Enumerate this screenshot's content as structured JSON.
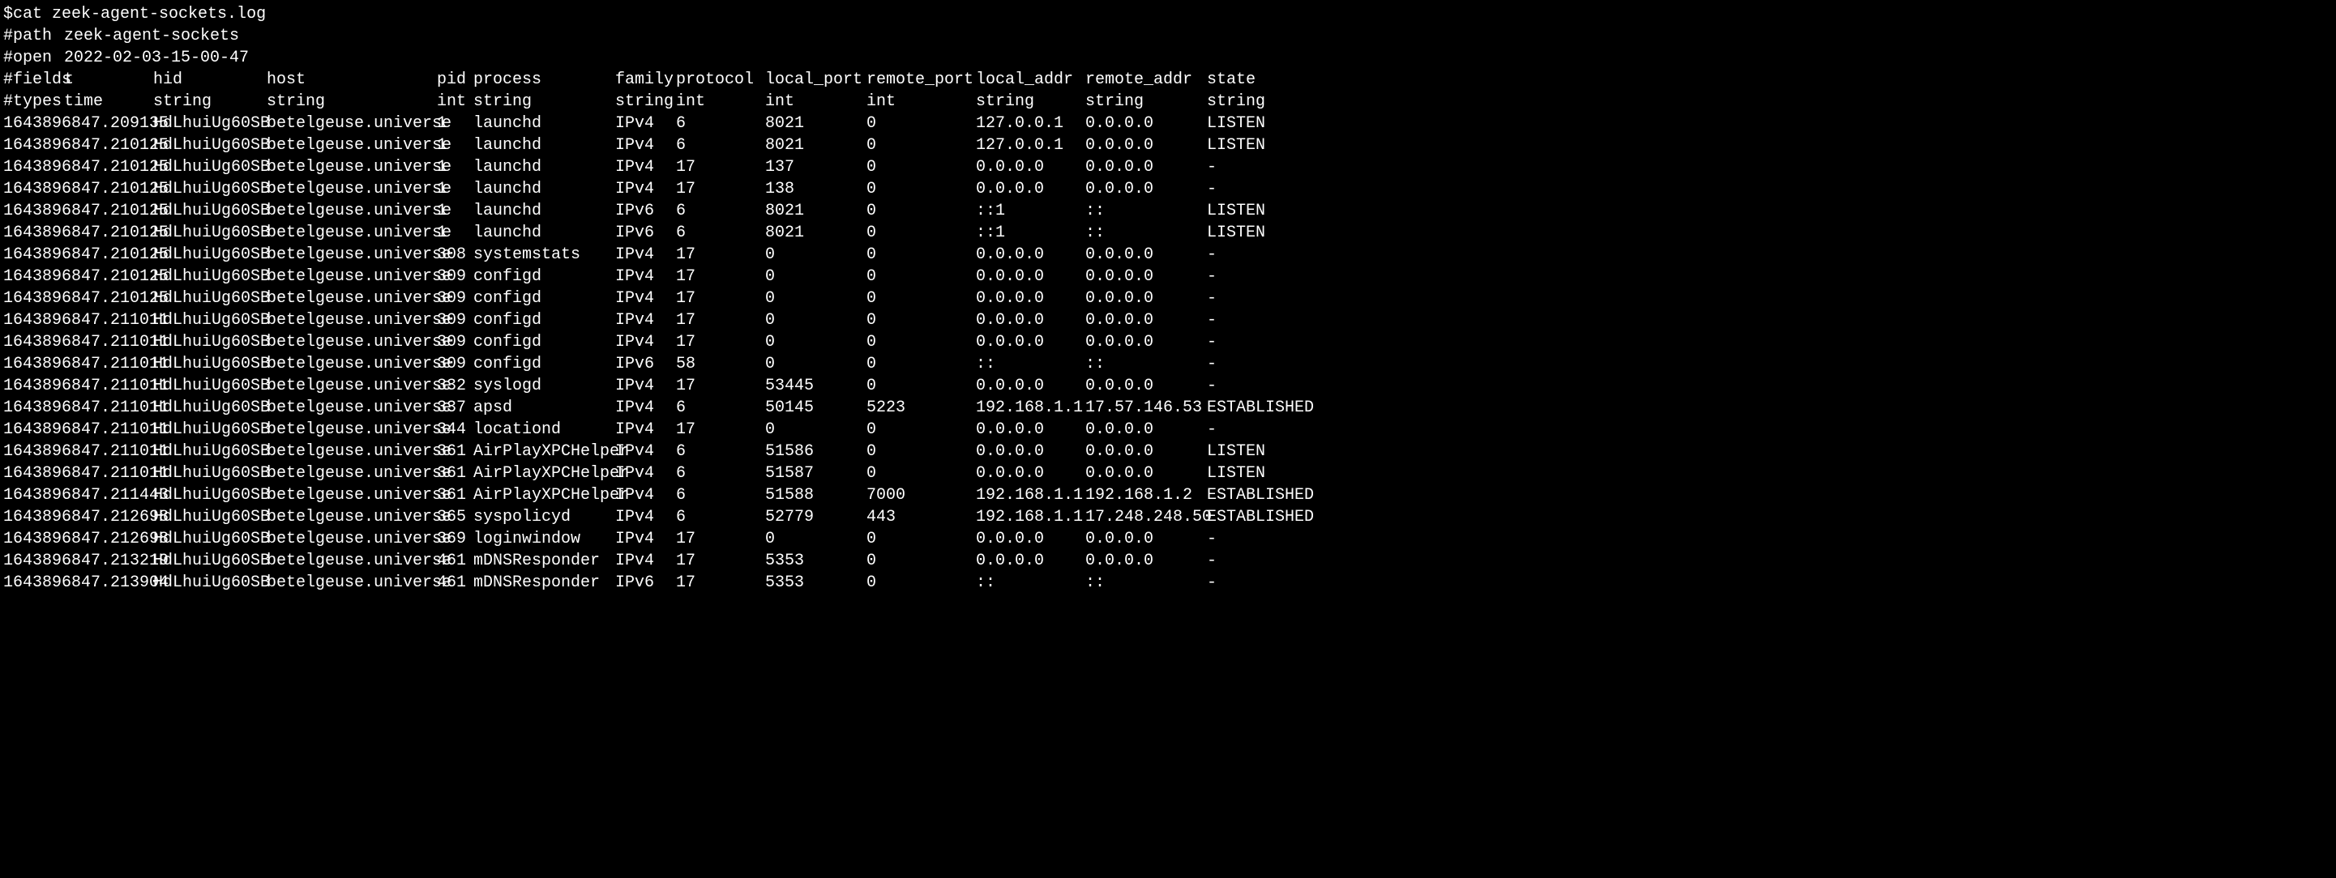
{
  "command": {
    "prompt": "$ ",
    "text": "cat zeek-agent-sockets.log"
  },
  "meta": {
    "path_key": "#path",
    "path_value": "zeek-agent-sockets",
    "open_key": "#open",
    "open_value": "2022-02-03-15-00-47"
  },
  "headers": {
    "fields_key": "#fields",
    "fields": [
      "t",
      "hid",
      "host",
      "pid",
      "process",
      "family",
      "protocol",
      "local_port",
      "remote_port",
      "local_addr",
      "remote_addr",
      "state"
    ],
    "types_key": "#types",
    "types": [
      "time",
      "string",
      "string",
      "int",
      "string",
      "string",
      "int",
      "int",
      "int",
      "string",
      "string",
      "string"
    ]
  },
  "rows": [
    {
      "t": "1643896847.209135",
      "hid": "HdLhuiUg60SB",
      "host": "betelgeuse.universe",
      "pid": "1",
      "process": "launchd",
      "family": "IPv4",
      "protocol": "6",
      "local_port": "8021",
      "remote_port": "0",
      "local_addr": "127.0.0.1",
      "remote_addr": "0.0.0.0",
      "state": "LISTEN"
    },
    {
      "t": "1643896847.210125",
      "hid": "HdLhuiUg60SB",
      "host": "betelgeuse.universe",
      "pid": "1",
      "process": "launchd",
      "family": "IPv4",
      "protocol": "6",
      "local_port": "8021",
      "remote_port": "0",
      "local_addr": "127.0.0.1",
      "remote_addr": "0.0.0.0",
      "state": "LISTEN"
    },
    {
      "t": "1643896847.210125",
      "hid": "HdLhuiUg60SB",
      "host": "betelgeuse.universe",
      "pid": "1",
      "process": "launchd",
      "family": "IPv4",
      "protocol": "17",
      "local_port": "137",
      "remote_port": "0",
      "local_addr": "0.0.0.0",
      "remote_addr": "0.0.0.0",
      "state": "-"
    },
    {
      "t": "1643896847.210125",
      "hid": "HdLhuiUg60SB",
      "host": "betelgeuse.universe",
      "pid": "1",
      "process": "launchd",
      "family": "IPv4",
      "protocol": "17",
      "local_port": "138",
      "remote_port": "0",
      "local_addr": "0.0.0.0",
      "remote_addr": "0.0.0.0",
      "state": "-"
    },
    {
      "t": "1643896847.210125",
      "hid": "HdLhuiUg60SB",
      "host": "betelgeuse.universe",
      "pid": "1",
      "process": "launchd",
      "family": "IPv6",
      "protocol": "6",
      "local_port": "8021",
      "remote_port": "0",
      "local_addr": "::1",
      "remote_addr": "::",
      "state": "LISTEN"
    },
    {
      "t": "1643896847.210125",
      "hid": "HdLhuiUg60SB",
      "host": "betelgeuse.universe",
      "pid": "1",
      "process": "launchd",
      "family": "IPv6",
      "protocol": "6",
      "local_port": "8021",
      "remote_port": "0",
      "local_addr": "::1",
      "remote_addr": "::",
      "state": "LISTEN"
    },
    {
      "t": "1643896847.210125",
      "hid": "HdLhuiUg60SB",
      "host": "betelgeuse.universe",
      "pid": "308",
      "process": "systemstats",
      "family": "IPv4",
      "protocol": "17",
      "local_port": "0",
      "remote_port": "0",
      "local_addr": "0.0.0.0",
      "remote_addr": "0.0.0.0",
      "state": "-"
    },
    {
      "t": "1643896847.210125",
      "hid": "HdLhuiUg60SB",
      "host": "betelgeuse.universe",
      "pid": "309",
      "process": "configd",
      "family": "IPv4",
      "protocol": "17",
      "local_port": "0",
      "remote_port": "0",
      "local_addr": "0.0.0.0",
      "remote_addr": "0.0.0.0",
      "state": "-"
    },
    {
      "t": "1643896847.210125",
      "hid": "HdLhuiUg60SB",
      "host": "betelgeuse.universe",
      "pid": "309",
      "process": "configd",
      "family": "IPv4",
      "protocol": "17",
      "local_port": "0",
      "remote_port": "0",
      "local_addr": "0.0.0.0",
      "remote_addr": "0.0.0.0",
      "state": "-"
    },
    {
      "t": "1643896847.211011",
      "hid": "HdLhuiUg60SB",
      "host": "betelgeuse.universe",
      "pid": "309",
      "process": "configd",
      "family": "IPv4",
      "protocol": "17",
      "local_port": "0",
      "remote_port": "0",
      "local_addr": "0.0.0.0",
      "remote_addr": "0.0.0.0",
      "state": "-"
    },
    {
      "t": "1643896847.211011",
      "hid": "HdLhuiUg60SB",
      "host": "betelgeuse.universe",
      "pid": "309",
      "process": "configd",
      "family": "IPv4",
      "protocol": "17",
      "local_port": "0",
      "remote_port": "0",
      "local_addr": "0.0.0.0",
      "remote_addr": "0.0.0.0",
      "state": "-"
    },
    {
      "t": "1643896847.211011",
      "hid": "HdLhuiUg60SB",
      "host": "betelgeuse.universe",
      "pid": "309",
      "process": "configd",
      "family": "IPv6",
      "protocol": "58",
      "local_port": "0",
      "remote_port": "0",
      "local_addr": "::",
      "remote_addr": "::",
      "state": "-"
    },
    {
      "t": "1643896847.211011",
      "hid": "HdLhuiUg60SB",
      "host": "betelgeuse.universe",
      "pid": "332",
      "process": "syslogd",
      "family": "IPv4",
      "protocol": "17",
      "local_port": "53445",
      "remote_port": "0",
      "local_addr": "0.0.0.0",
      "remote_addr": "0.0.0.0",
      "state": "-"
    },
    {
      "t": "1643896847.211011",
      "hid": "HdLhuiUg60SB",
      "host": "betelgeuse.universe",
      "pid": "337",
      "process": "apsd",
      "family": "IPv4",
      "protocol": "6",
      "local_port": "50145",
      "remote_port": "5223",
      "local_addr": "192.168.1.1",
      "remote_addr": "17.57.146.53",
      "state": "ESTABLISHED"
    },
    {
      "t": "1643896847.211011",
      "hid": "HdLhuiUg60SB",
      "host": "betelgeuse.universe",
      "pid": "344",
      "process": "locationd",
      "family": "IPv4",
      "protocol": "17",
      "local_port": "0",
      "remote_port": "0",
      "local_addr": "0.0.0.0",
      "remote_addr": "0.0.0.0",
      "state": "-"
    },
    {
      "t": "1643896847.211011",
      "hid": "HdLhuiUg60SB",
      "host": "betelgeuse.universe",
      "pid": "361",
      "process": "AirPlayXPCHelper",
      "family": "IPv4",
      "protocol": "6",
      "local_port": "51586",
      "remote_port": "0",
      "local_addr": "0.0.0.0",
      "remote_addr": "0.0.0.0",
      "state": "LISTEN"
    },
    {
      "t": "1643896847.211011",
      "hid": "HdLhuiUg60SB",
      "host": "betelgeuse.universe",
      "pid": "361",
      "process": "AirPlayXPCHelper",
      "family": "IPv4",
      "protocol": "6",
      "local_port": "51587",
      "remote_port": "0",
      "local_addr": "0.0.0.0",
      "remote_addr": "0.0.0.0",
      "state": "LISTEN"
    },
    {
      "t": "1643896847.211443",
      "hid": "HdLhuiUg60SB",
      "host": "betelgeuse.universe",
      "pid": "361",
      "process": "AirPlayXPCHelper",
      "family": "IPv4",
      "protocol": "6",
      "local_port": "51588",
      "remote_port": "7000",
      "local_addr": "192.168.1.1",
      "remote_addr": "192.168.1.2",
      "state": "ESTABLISHED"
    },
    {
      "t": "1643896847.212698",
      "hid": "HdLhuiUg60SB",
      "host": "betelgeuse.universe",
      "pid": "365",
      "process": "syspolicyd",
      "family": "IPv4",
      "protocol": "6",
      "local_port": "52779",
      "remote_port": "443",
      "local_addr": "192.168.1.1",
      "remote_addr": "17.248.248.50",
      "state": "ESTABLISHED"
    },
    {
      "t": "1643896847.212698",
      "hid": "HdLhuiUg60SB",
      "host": "betelgeuse.universe",
      "pid": "369",
      "process": "loginwindow",
      "family": "IPv4",
      "protocol": "17",
      "local_port": "0",
      "remote_port": "0",
      "local_addr": "0.0.0.0",
      "remote_addr": "0.0.0.0",
      "state": "-"
    },
    {
      "t": "1643896847.213219",
      "hid": "HdLhuiUg60SB",
      "host": "betelgeuse.universe",
      "pid": "461",
      "process": "mDNSResponder",
      "family": "IPv4",
      "protocol": "17",
      "local_port": "5353",
      "remote_port": "0",
      "local_addr": "0.0.0.0",
      "remote_addr": "0.0.0.0",
      "state": "-"
    },
    {
      "t": "1643896847.213904",
      "hid": "HdLhuiUg60SB",
      "host": "betelgeuse.universe",
      "pid": "461",
      "process": "mDNSResponder",
      "family": "IPv6",
      "protocol": "17",
      "local_port": "5353",
      "remote_port": "0",
      "local_addr": "::",
      "remote_addr": "::",
      "state": "-"
    }
  ]
}
